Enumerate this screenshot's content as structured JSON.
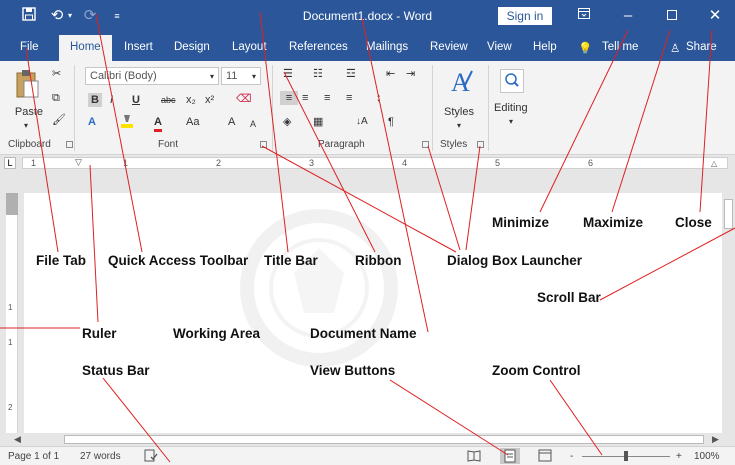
{
  "title_bar": {
    "document_title": "Document1.docx  -  Word",
    "sign_in": "Sign in",
    "icons": [
      "save-icon",
      "undo-icon",
      "redo-icon",
      "customize-qat-icon",
      "ribbon-display-options-icon",
      "minimize-icon",
      "maximize-icon",
      "close-icon"
    ]
  },
  "tabs": [
    "File",
    "Home",
    "Insert",
    "Design",
    "Layout",
    "References",
    "Mailings",
    "Review",
    "View",
    "Help",
    "Tell me",
    "Share"
  ],
  "active_tab": "Home",
  "ribbon": {
    "clipboard": {
      "paste": "Paste",
      "label": "Clipboard"
    },
    "font": {
      "font_name": "Calibri (Body)",
      "font_size": "11",
      "label": "Font",
      "row2": [
        "B",
        "I",
        "U",
        "abc",
        "x₂",
        "x²"
      ],
      "row3": [
        "A",
        "A",
        "Aa",
        "A",
        "A"
      ]
    },
    "paragraph": {
      "label": "Paragraph",
      "pilcrow": "¶"
    },
    "styles": {
      "button": "Styles",
      "label": "Styles"
    },
    "editing": {
      "button": "Editing"
    }
  },
  "ruler": {
    "numbers": [
      "1",
      "1",
      "2",
      "3",
      "4",
      "5",
      "6"
    ]
  },
  "vruler": {
    "numbers": [
      "1",
      "1",
      "2"
    ]
  },
  "status_bar": {
    "page": "Page 1 of 1",
    "words": "27 words",
    "zoom_minus": "-",
    "zoom_plus": "+",
    "zoom": "100%"
  },
  "annotations": {
    "minimize": "Minimize",
    "maximize": "Maximize",
    "close": "Close",
    "file_tab": "File Tab",
    "quick_access_toolbar": "Quick Access Toolbar",
    "title_bar": "Title Bar",
    "ribbon": "Ribbon",
    "dialog_box_launcher": "Dialog Box Launcher",
    "scroll_bar": "Scroll Bar",
    "ruler": "Ruler",
    "working_area": "Working Area",
    "document_name": "Document Name",
    "status_bar": "Status Bar",
    "view_buttons": "View Buttons",
    "zoom_control": "Zoom Control"
  },
  "colors": {
    "title_bar": "#2b579a",
    "annotation_line": "#e02020",
    "ribbon_bg": "#f3f3f3"
  }
}
